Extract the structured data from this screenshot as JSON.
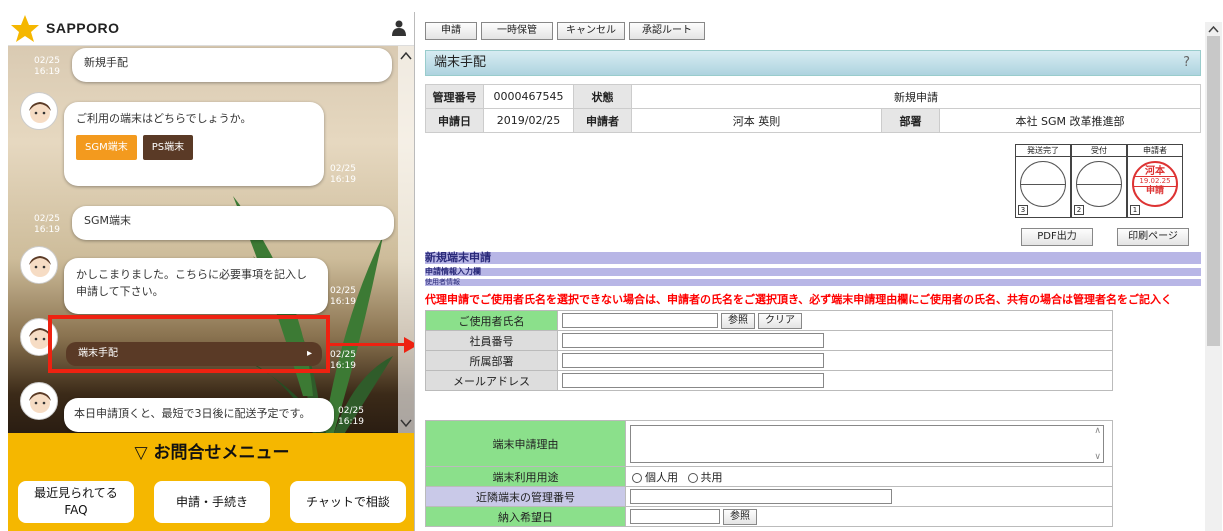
{
  "chat": {
    "brand": "SAPPORO",
    "messages": [
      {
        "time": "02/25\n16:19",
        "text": "新規手配"
      },
      {
        "text": "ご利用の端末はどちらでしょうか。",
        "options": [
          "SGM端末",
          "PS端末"
        ],
        "time": "02/25\n16:19"
      },
      {
        "time": "02/25\n16:19",
        "text": "SGM端末"
      },
      {
        "text": "かしこまりました。こちらに必要事項を記入し申請して下さい。",
        "time": "02/25\n16:19"
      },
      {
        "link": "端末手配",
        "time": "02/25\n16:19"
      },
      {
        "text": "本日申請頂くと、最短で3日後に配送予定です。",
        "time": "02/25\n16:19"
      }
    ],
    "menu_title": "▽ お問合せメニュー",
    "quick": [
      "最近見られてる\nFAQ",
      "申請・手続き",
      "チャットで相談"
    ],
    "colors": {
      "accent": "#f5b700",
      "brown": "#5a3a26",
      "orange": "#f39a1e",
      "highlight": "#ee2211"
    }
  },
  "form": {
    "toolbar": [
      "申請",
      "一時保管",
      "キャンセル",
      "承認ルート"
    ],
    "title": "端末手配",
    "help": "?",
    "info": {
      "row1": {
        "k1": "管理番号",
        "v1": "0000467545",
        "k2": "状態",
        "v2": "新規申請"
      },
      "row2": {
        "k1": "申請日",
        "v1": "2019/02/25",
        "k2": "申請者",
        "v2": "河本 英則",
        "k3": "部署",
        "v3": "本社 SGM 改革推進部"
      }
    },
    "seals": [
      {
        "label": "発送完了",
        "num": "3"
      },
      {
        "label": "受付",
        "num": "2"
      },
      {
        "label": "申請者",
        "num": "1",
        "stamp": {
          "name": "河本",
          "date": "19.02.25",
          "action": "申請"
        }
      }
    ],
    "buttons": {
      "pdf": "PDF出力",
      "print": "印刷ページ"
    },
    "section": {
      "title": "新規端末申請",
      "sub1": "申請情報入力欄",
      "sub2": "使用者情報"
    },
    "warning": "代理申請でご使用者氏名を選択できない場合は、申請者の氏名をご選択頂き、必ず端末申請理由欄にご使用者の氏名、共有の場合は管理者名をご記入く",
    "user_fields": [
      "ご使用者氏名",
      "社員番号",
      "所属部署",
      "メールアドレス"
    ],
    "ref": "参照",
    "clear": "クリア",
    "req_fields": {
      "reason": "端末申請理由",
      "usage": "端末利用用途",
      "usage_opts": [
        "個人用",
        "共用"
      ],
      "nearby": "近隣端末の管理番号",
      "date": "納入希望日"
    }
  }
}
